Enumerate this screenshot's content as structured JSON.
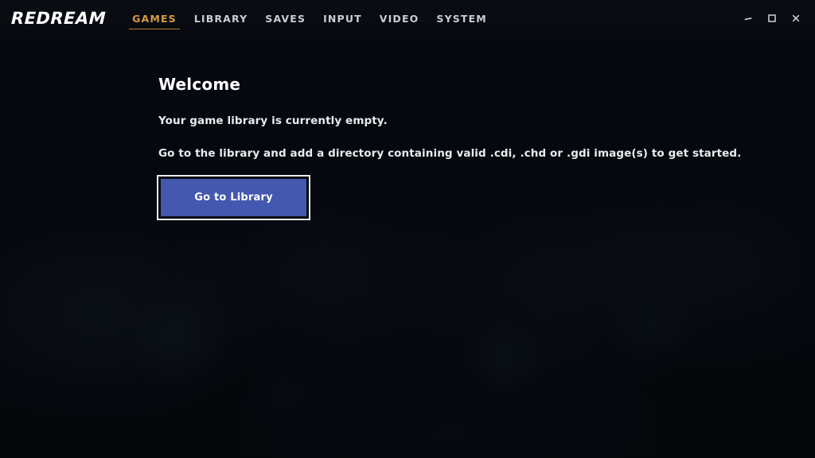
{
  "app": {
    "brand": "REDREAM",
    "accent_color": "#d79d3f",
    "button_color": "#4358ae",
    "background_color": "#05080e",
    "titlebar_color": "#0b0d14"
  },
  "nav": {
    "items": [
      {
        "label": "GAMES",
        "active": true,
        "name": "nav-item-games"
      },
      {
        "label": "LIBRARY",
        "active": false,
        "name": "nav-item-library"
      },
      {
        "label": "SAVES",
        "active": false,
        "name": "nav-item-saves"
      },
      {
        "label": "INPUT",
        "active": false,
        "name": "nav-item-input"
      },
      {
        "label": "VIDEO",
        "active": false,
        "name": "nav-item-video"
      },
      {
        "label": "SYSTEM",
        "active": false,
        "name": "nav-item-system"
      }
    ]
  },
  "window_controls": {
    "minimize": "minimize-icon",
    "maximize": "maximize-icon",
    "close": "close-icon"
  },
  "main": {
    "title": "Welcome",
    "line1": "Your game library is currently empty.",
    "line2": "Go to the library and add a directory containing valid .cdi, .chd or .gdi image(s) to get started.",
    "button_label": "Go to Library"
  }
}
